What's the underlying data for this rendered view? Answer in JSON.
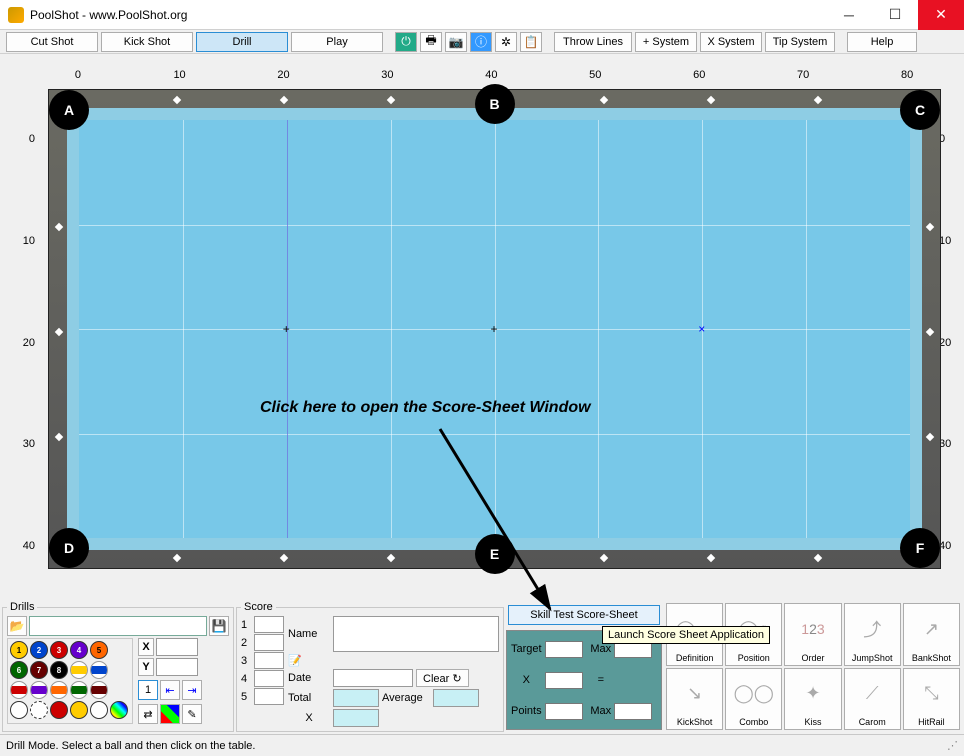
{
  "window": {
    "title": "PoolShot - www.PoolShot.org"
  },
  "toolbar": {
    "cut_shot": "Cut Shot",
    "kick_shot": "Kick Shot",
    "drill": "Drill",
    "play": "Play",
    "throw_lines": "Throw Lines",
    "plus_system": "+ System",
    "x_system": "X System",
    "tip_system": "Tip System",
    "help": "Help"
  },
  "table": {
    "top_ruler": [
      "0",
      "10",
      "20",
      "30",
      "40",
      "50",
      "60",
      "70",
      "80"
    ],
    "side_ruler": [
      "0",
      "10",
      "20",
      "30",
      "40"
    ],
    "pockets": [
      "A",
      "B",
      "C",
      "D",
      "E",
      "F"
    ],
    "annotation": "Click here to open the Score-Sheet Window"
  },
  "drills": {
    "legend": "Drills",
    "x": "X",
    "y": "Y",
    "x_val": "",
    "y_val": "",
    "page": "1"
  },
  "score": {
    "legend": "Score",
    "rows": [
      "1",
      "2",
      "3",
      "4",
      "5"
    ],
    "name": "Name",
    "date": "Date",
    "total": "Total",
    "average": "Average",
    "x": "X",
    "clear": "Clear"
  },
  "mid": {
    "skill_btn": "Skill Test Score-Sheet",
    "tooltip": "Launch Score Sheet Application",
    "target": "Target",
    "max": "Max",
    "points": "Points",
    "x": "X",
    "eq": "="
  },
  "shots": {
    "row1": [
      "Definition",
      "Position",
      "Order",
      "JumpShot",
      "BankShot"
    ],
    "row2": [
      "KickShot",
      "Combo",
      "Kiss",
      "Carom",
      "HitRail"
    ]
  },
  "status": "Drill Mode. Select a ball and then click on the table."
}
